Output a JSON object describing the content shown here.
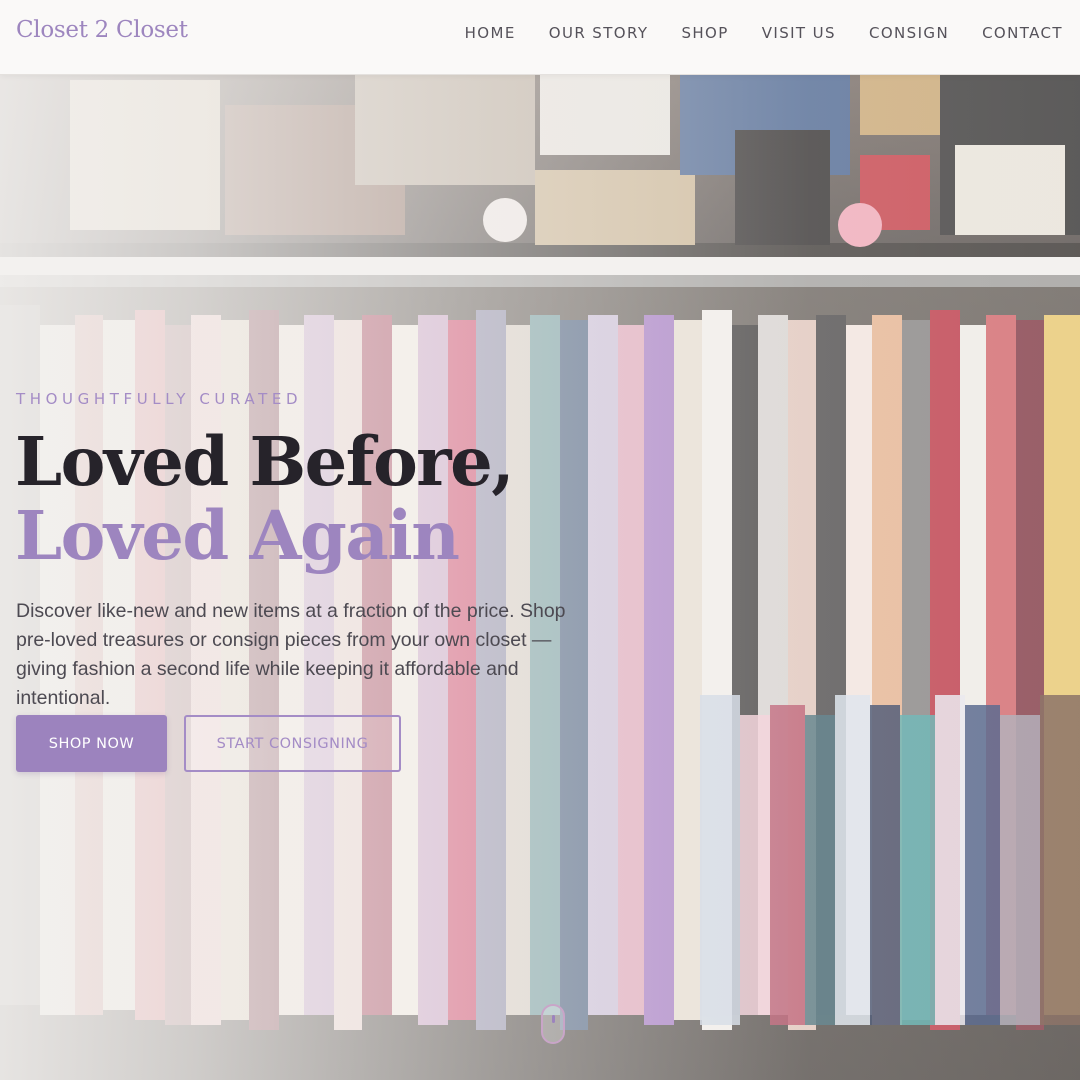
{
  "header": {
    "logo": "Closet 2 Closet",
    "nav": [
      "HOME",
      "OUR STORY",
      "SHOP",
      "VISIT US",
      "CONSIGN",
      "CONTACT"
    ]
  },
  "hero": {
    "eyebrow": "THOUGHTFULLY CURATED",
    "headline_line1": "Loved Before,",
    "headline_line2": "Loved Again",
    "description": "Discover like-new and new items at a fraction of the price. Shop pre-loved treasures or consign pieces from your own closet — giving fashion a second life while keeping it affordable and intentional.",
    "primary_button": "SHOP NOW",
    "secondary_button": "START CONSIGNING"
  },
  "colors": {
    "brand_purple": "#9d85bf",
    "button_purple": "#9c83be",
    "heading_dark": "#26232a",
    "body_text": "#4d4a52",
    "nav_text": "#55525a"
  },
  "icons": {
    "scroll": "mouse-scroll-icon"
  }
}
